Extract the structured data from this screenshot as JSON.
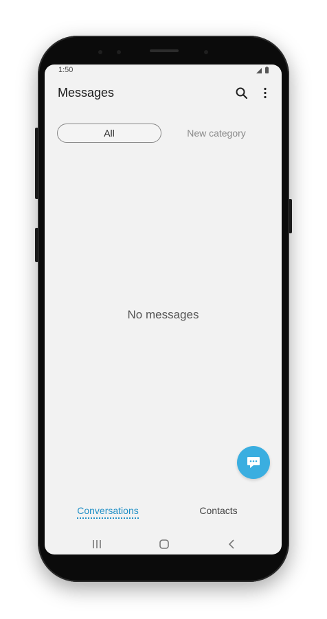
{
  "status_bar": {
    "time": "1:50",
    "icons": [
      "signal-icon",
      "battery-icon"
    ]
  },
  "header": {
    "title": "Messages",
    "actions": [
      "search-icon",
      "more-options-icon"
    ]
  },
  "categories": {
    "all_label": "All",
    "new_label": "New category",
    "selected": "All"
  },
  "main": {
    "empty_text": "No messages"
  },
  "fab": {
    "icon": "compose-message-icon",
    "color": "#3aaee0"
  },
  "bottom_tabs": {
    "conversations_label": "Conversations",
    "contacts_label": "Contacts",
    "active": "Conversations",
    "active_color": "#1f8fc6"
  },
  "nav_bar": {
    "buttons": [
      "recent-apps-icon",
      "home-icon",
      "back-icon"
    ]
  }
}
